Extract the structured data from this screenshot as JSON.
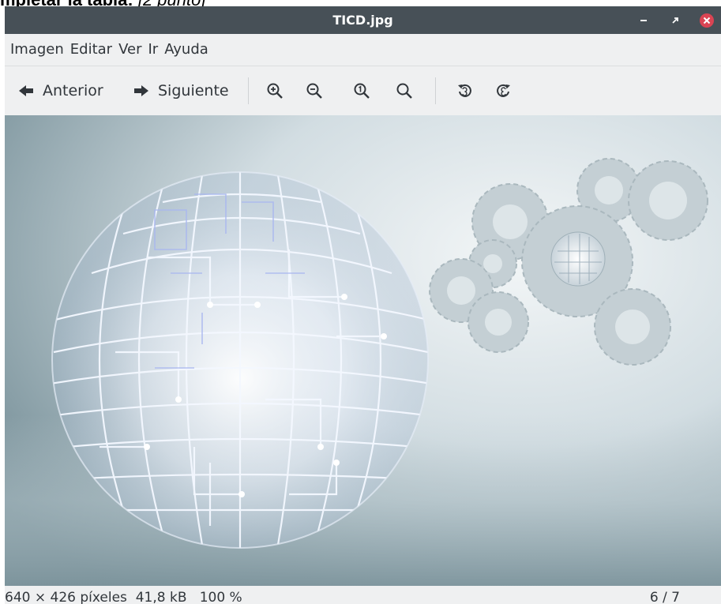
{
  "document": {
    "heading": "mpletar la tabla:",
    "heading_note": "[2 punto]"
  },
  "window": {
    "title": "TICD.jpg",
    "titlebar_color": "#475057",
    "close_color": "#da4453",
    "controls": [
      "minimize-icon",
      "maximize-icon",
      "close-icon"
    ]
  },
  "menu": {
    "items": [
      "Imagen",
      "Editar",
      "Ver",
      "Ir",
      "Ayuda"
    ]
  },
  "toolbar": {
    "previous_label": "Anterior",
    "next_label": "Siguiente",
    "icons": [
      "arrow-left-icon",
      "arrow-right-icon",
      "zoom-in-icon",
      "zoom-out-icon",
      "zoom-original-icon",
      "zoom-fit-icon",
      "rotate-left-icon",
      "rotate-right-icon"
    ]
  },
  "status": {
    "dimensions": "640 × 426 píxeles",
    "file_size": "41,8 kB",
    "zoom": "100 %",
    "position": "6 / 7"
  }
}
